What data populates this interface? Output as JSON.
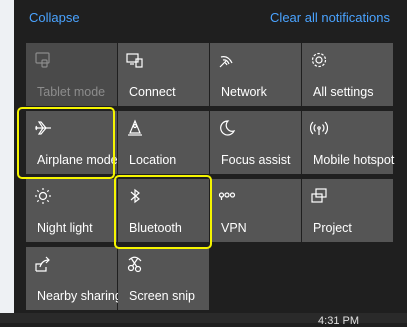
{
  "header": {
    "collapse_label": "Collapse",
    "clear_label": "Clear all notifications"
  },
  "tiles": [
    {
      "label": "Tablet mode",
      "icon": "tablet-mode-icon",
      "enabled": false
    },
    {
      "label": "Connect",
      "icon": "connect-icon",
      "enabled": true
    },
    {
      "label": "Network",
      "icon": "network-icon",
      "enabled": true
    },
    {
      "label": "All settings",
      "icon": "gear-icon",
      "enabled": true
    },
    {
      "label": "Airplane mode",
      "icon": "airplane-icon",
      "enabled": true
    },
    {
      "label": "Location",
      "icon": "location-icon",
      "enabled": true
    },
    {
      "label": "Focus assist",
      "icon": "moon-icon",
      "enabled": true
    },
    {
      "label": "Mobile hotspot",
      "icon": "hotspot-icon",
      "enabled": true
    },
    {
      "label": "Night light",
      "icon": "sun-icon",
      "enabled": true
    },
    {
      "label": "Bluetooth",
      "icon": "bluetooth-icon",
      "enabled": true
    },
    {
      "label": "VPN",
      "icon": "vpn-icon",
      "enabled": true
    },
    {
      "label": "Project",
      "icon": "project-icon",
      "enabled": true
    },
    {
      "label": "Nearby sharing",
      "icon": "nearby-sharing-icon",
      "enabled": true
    },
    {
      "label": "Screen snip",
      "icon": "screen-snip-icon",
      "enabled": true
    }
  ],
  "colors": {
    "accent": "#4aa3ff",
    "tile": "#555555",
    "tile_disabled": "#4a4a4a",
    "highlight": "#f5f500"
  },
  "taskbar": {
    "time": "4:31 PM"
  }
}
